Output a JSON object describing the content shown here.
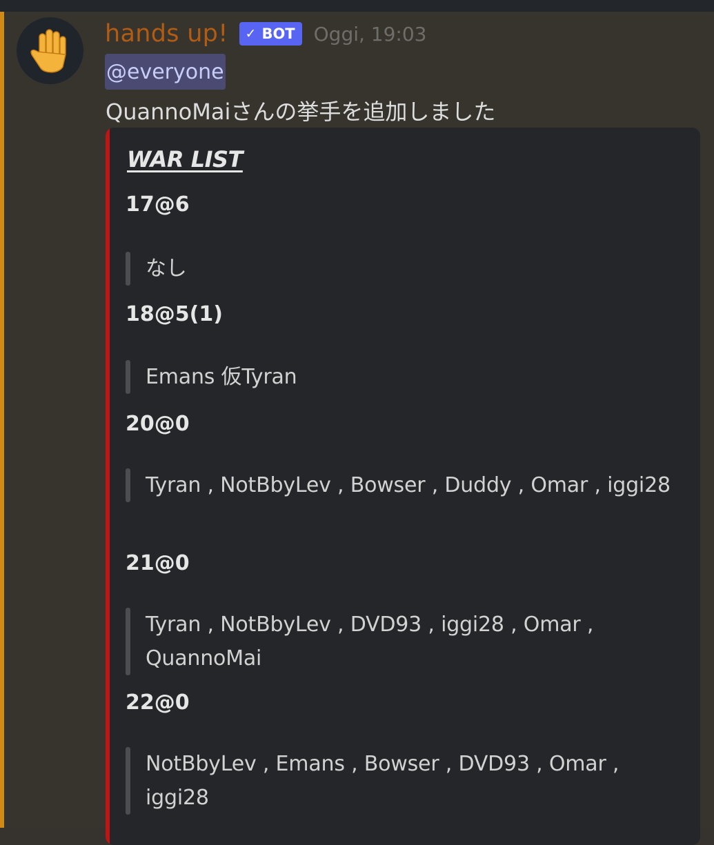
{
  "message": {
    "author": "hands up!",
    "bot_tag": "BOT",
    "bot_check_icon": "✓",
    "timestamp": "Oggi, 19:03",
    "avatar_icon": "raised-hand-icon",
    "mention": "@everyone",
    "content": "QuannoMaiさんの挙手を追加しました"
  },
  "embed": {
    "title": "WAR LIST",
    "accent_color": "#c01515",
    "fields": [
      {
        "name": "17@6",
        "value": "なし"
      },
      {
        "name": "18@5(1)",
        "value": "Emans 仮Tyran"
      },
      {
        "name": "20@0",
        "value": "Tyran , NotBbyLev , Bowser , Duddy , Omar , iggi28"
      },
      {
        "name": "21@0",
        "value": "Tyran , NotBbyLev , DVD93 , iggi28 , Omar , QuannoMai"
      },
      {
        "name": "22@0",
        "value": "NotBbyLev , Emans , Bowser , DVD93 , Omar , iggi28"
      }
    ]
  },
  "colors": {
    "highlight": "#d08a17",
    "username": "#b15c12",
    "bot_tag": "#5865f2",
    "mention_bg": "#4a4a72"
  }
}
